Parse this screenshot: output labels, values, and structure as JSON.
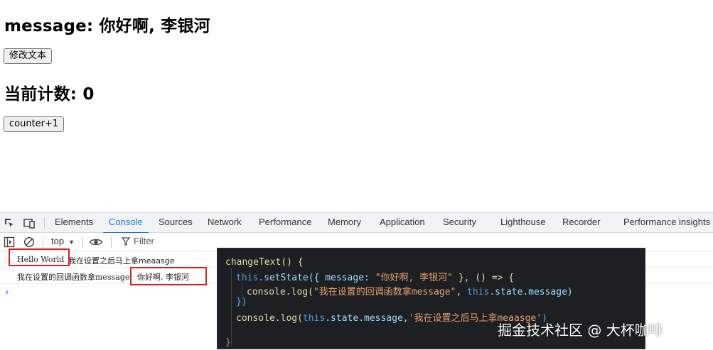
{
  "page": {
    "message_heading": "message: 你好啊, 李银河",
    "change_button": "修改文本",
    "count_heading": "当前计数: 0",
    "counter_button": "counter+1"
  },
  "devtools": {
    "tabs": [
      "Elements",
      "Console",
      "Sources",
      "Network",
      "Performance",
      "Memory",
      "Application",
      "Security",
      "Lighthouse",
      "Recorder",
      "Performance insights"
    ],
    "active_tab": "Console",
    "context": "top",
    "filter_placeholder": "Filter",
    "logs": [
      {
        "a": "Hello World",
        "b": "我在设置之后马上拿meaasge"
      },
      {
        "a": "我在设置的回调函数拿message",
        "b": "你好啊, 李银河"
      }
    ],
    "prompt": "›"
  },
  "code": {
    "line1": "changeText() {",
    "l2_this": "this",
    "l2_rest1": ".setState({ message: ",
    "l2_str": "\"你好啊, 李银河\"",
    "l2_rest2": " }, () => {",
    "l3_fn": "console.log(",
    "l3_str": "\"我在设置的回调函数拿message\"",
    "l3_this": "this",
    "l3_rest": ".state.message)",
    "line4": "})",
    "l5_fn": "console.log(",
    "l5_this": "this",
    "l5_mid": ".state.message,",
    "l5_str": "'我在设置之后马上拿meaasge'",
    "l5_end": ")",
    "line6": "}"
  },
  "watermark": "掘金技术社区 @ 大杯咖啡",
  "colors": {
    "accent": "#1a73e8",
    "highlight_box": "#d42121",
    "code_bg": "#1e1f22"
  }
}
